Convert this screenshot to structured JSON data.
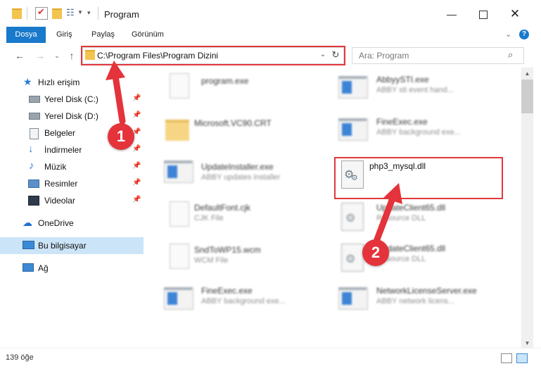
{
  "window": {
    "title": "Program"
  },
  "ribbon": {
    "tabs": [
      "Dosya",
      "Giriş",
      "Paylaş",
      "Görünüm"
    ]
  },
  "address": {
    "path": "C:\\Program Files\\Program Dizini"
  },
  "search": {
    "placeholder": "Ara: Program"
  },
  "sidebar": {
    "quick_access": "Hızlı erişim",
    "items": [
      {
        "label": "Yerel Disk (C:)",
        "pinned": true
      },
      {
        "label": "Yerel Disk (D:)",
        "pinned": true
      },
      {
        "label": "Belgeler",
        "pinned": true
      },
      {
        "label": "İndirmeler",
        "pinned": true
      },
      {
        "label": "Müzik",
        "pinned": true
      },
      {
        "label": "Resimler",
        "pinned": true
      },
      {
        "label": "Videolar",
        "pinned": true
      }
    ],
    "onedrive": "OneDrive",
    "this_pc": "Bu bilgisayar",
    "network": "Ağ"
  },
  "files": {
    "left": [
      {
        "name": "program.exe",
        "desc": ""
      },
      {
        "name": "Microsoft.VC90.CRT",
        "desc": ""
      },
      {
        "name": "UpdateInstaller.exe",
        "desc": "ABBY updates installer"
      },
      {
        "name": "DefaultFont.cjk",
        "desc": "CJK File"
      },
      {
        "name": "SndToWP15.wcm",
        "desc": "WCM File"
      },
      {
        "name": "FineExec.exe",
        "desc": "ABBY background exe..."
      }
    ],
    "right": [
      {
        "name": "AbbyySTI.exe",
        "desc": "ABBY sti event hand..."
      },
      {
        "name": "FineExec.exe",
        "desc": "ABBY background exe..."
      },
      {
        "name": "php3_mysql.dll",
        "desc": ""
      },
      {
        "name": "UpdateClient65.dll",
        "desc": "Resource DLL"
      },
      {
        "name": "UpdateClient65.dll",
        "desc": "Resource DLL"
      },
      {
        "name": "NetworkLicenseServer.exe",
        "desc": "ABBY network licens..."
      }
    ]
  },
  "status": {
    "count": "139 öğe"
  },
  "callouts": {
    "one": "1",
    "two": "2"
  },
  "colors": {
    "accent": "#1979ca",
    "highlight": "#e0383e",
    "selected": "#cce4f7"
  }
}
